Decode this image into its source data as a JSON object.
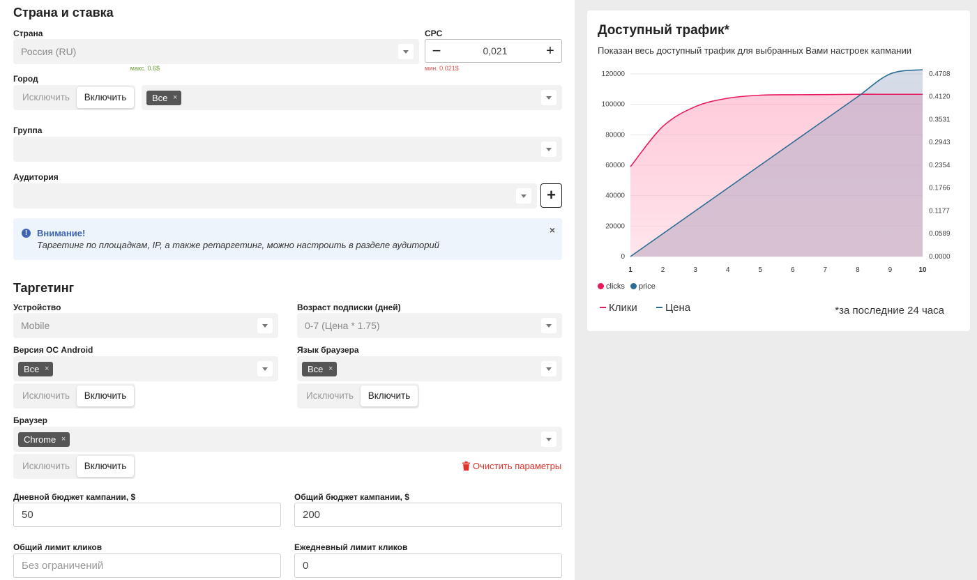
{
  "country_section": {
    "title": "Страна и ставка",
    "country_label": "Страна",
    "country_value": "Россия (RU)",
    "cpc_label": "CPC",
    "cpc_value": "0,021",
    "cpc_min": "мин. 0.021$",
    "cpc_max": "макс. 0.6$",
    "city_label": "Город",
    "city_exclude": "Исключить",
    "city_include": "Включить",
    "city_chip": "Все",
    "group_label": "Группа",
    "audience_label": "Аудитория",
    "audience_add": "+"
  },
  "alert": {
    "icon": "!",
    "title": "Внимание!",
    "text": "Таргетинг по площадкам, IP, а также ретаргетинг, можно настроить в разделе аудиторий",
    "close": "×"
  },
  "targeting": {
    "title": "Таргетинг",
    "device_label": "Устройство",
    "device_value": "Mobile",
    "age_label": "Возраст подписки (дней)",
    "age_value": "0-7 (Цена * 1.75)",
    "os_label": "Версия ОС Android",
    "os_chip": "Все",
    "lang_label": "Язык браузера",
    "lang_chip": "Все",
    "exclude": "Исключить",
    "include": "Включить",
    "browser_label": "Браузер",
    "browser_chip": "Chrome",
    "clear_label": "Очистить параметры",
    "chip_remove": "×"
  },
  "budget": {
    "daily_label": "Дневной бюджет кампании, $",
    "daily_value": "50",
    "total_label": "Общий бюджет кампании, $",
    "total_value": "200",
    "click_limit_label": "Общий лимит кликов",
    "click_limit_placeholder": "Без ограничений",
    "daily_click_limit_label": "Ежедневный лимит кликов",
    "daily_click_limit_value": "0"
  },
  "traffic_card": {
    "title": "Доступный трафик*",
    "subtitle": "Показан весь доступный трафик для выбранных Вами настроек капмании",
    "legend_clicks": "Клики",
    "legend_price": "Цена",
    "note": "*за последние 24 часа"
  },
  "colors": {
    "clicks": "#e8195a",
    "price": "#2a6c93",
    "accent_red": "#e2312a",
    "alert_blue": "#3f64b1"
  },
  "chart_data": {
    "type": "area",
    "x": [
      1,
      2,
      3,
      4,
      5,
      6,
      7,
      8,
      9,
      10
    ],
    "series": [
      {
        "name": "clicks",
        "axis": "left",
        "values": [
          59000,
          85500,
          98500,
          104000,
          106000,
          106300,
          106400,
          106600,
          106600,
          106600
        ]
      },
      {
        "name": "price",
        "axis": "right",
        "values": [
          0.0,
          0.0589,
          0.1177,
          0.1766,
          0.2354,
          0.2943,
          0.3531,
          0.412,
          0.4708,
          0.53
        ]
      }
    ],
    "x_ticks": [
      "1",
      "2",
      "3",
      "4",
      "5",
      "6",
      "7",
      "8",
      "9",
      "10"
    ],
    "y_left_ticks": [
      "0",
      "20000",
      "40000",
      "60000",
      "80000",
      "100000",
      "120000"
    ],
    "y_right_ticks": [
      "0.0000",
      "0.0589",
      "0.1177",
      "0.1766",
      "0.2354",
      "0.2943",
      "0.3531",
      "0.4120",
      "0.4708"
    ],
    "ylim_left": [
      0,
      120000
    ],
    "ylim_right": [
      0,
      0.4708
    ],
    "grid": true,
    "legend": [
      "clicks",
      "price"
    ]
  }
}
